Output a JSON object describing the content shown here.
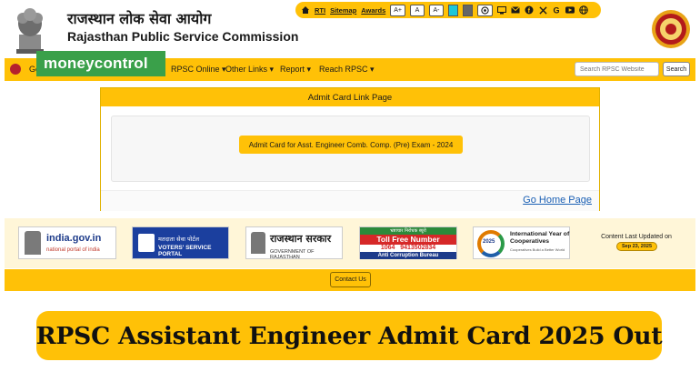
{
  "header": {
    "title_hindi": "राजस्थान लोक सेवा आयोग",
    "title_english": "Rajasthan Public Service Commission"
  },
  "topbar": {
    "links": [
      "RTI",
      "Sitemap",
      "Awards"
    ],
    "font_buttons": [
      "A+",
      "A",
      "A-"
    ],
    "contrast_colors": [
      "#1ec7d8",
      "#666666"
    ]
  },
  "nav": {
    "items": [
      "Ge",
      "RPSC Online ▾",
      "Other Links ▾",
      "Report ▾",
      "Reach RPSC ▾"
    ],
    "search_placeholder": "Search RPSC Website",
    "search_button": "Search"
  },
  "watermark": "moneycontrol",
  "card": {
    "heading": "Admit Card Link Page",
    "admit_button": "Admit Card for Asst. Engineer Comb. Comp. (Pre) Exam - 2024",
    "go_home": "Go Home Page"
  },
  "logos": {
    "india_gov_title": "india.gov.in",
    "india_gov_sub": "national portal of india",
    "voters_hindi": "मतदाता सेवा पोर्टल",
    "voters_english": "VOTERS' SERVICE PORTAL",
    "rajasthan_hindi": "राजस्थान सरकार",
    "rajasthan_english": "GOVERNMENT OF RAJASTHAN",
    "acb_top": "भ्रष्टाचार निरोधक ब्यूरो",
    "acb_title": "Toll Free Number",
    "acb_number": "1064",
    "acb_phone": "9413502834",
    "acb_bureau": "Anti Corruption Bureau",
    "coop_year": "2025",
    "coop_title": "International Year of Cooperatives",
    "coop_sub": "Cooperatives Build a Better World"
  },
  "updated": {
    "label": "Content Last Updated on",
    "date": "Sep 23, 2025"
  },
  "footer": {
    "contact": "Contact Us"
  },
  "headline": "RPSC Assistant Engineer Admit Card 2025 Out",
  "colors": {
    "accent": "#ffc107",
    "link": "#1a5fb4"
  }
}
